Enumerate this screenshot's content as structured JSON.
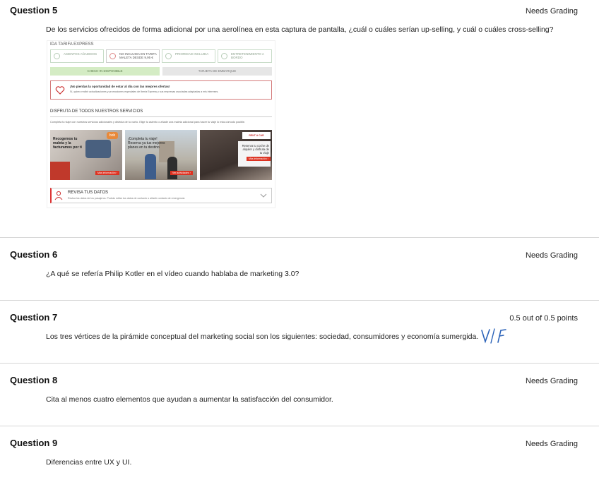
{
  "questions": [
    {
      "title": "Question 5",
      "status": "Needs Grading",
      "text": "De los servicios ofrecidos de forma adicional por una aerolínea en esta captura de pantalla, ¿cuál o cuáles serían up-selling, y cuál o cuáles cross-selling?"
    },
    {
      "title": "Question 6",
      "status": "Needs Grading",
      "text": "¿A qué se refería Philip Kotler en el vídeo cuando hablaba de marketing 3.0?"
    },
    {
      "title": "Question 7",
      "status": "0.5 out of 0.5 points",
      "text": "Los tres vértices de la pirámide conceptual del marketing social son los siguientes: sociedad, consumidores y economía sumergida.",
      "handwritten_mark": "V/F"
    },
    {
      "title": "Question 8",
      "status": "Needs Grading",
      "text": "Cita al menos cuatro elementos que ayudan a aumentar la satisfacción del consumidor."
    },
    {
      "title": "Question 9",
      "status": "Needs Grading",
      "text": "Diferencias entre UX y UI."
    }
  ],
  "screenshot": {
    "header": "IDA TARIFA EXPRESS",
    "services": [
      "ASIENTOS AÑADIDOS",
      "NO INCLUIDA EN TARIFA MALETA DESDE 9,95 €",
      "PRIORIDAD INCLUIDA",
      "ENTRETENIMIENTO A BORDO"
    ],
    "checkin": "CHECK-IN DISPONIBLE",
    "boarding": "TARJETA DE EMBARQUE",
    "promo_title": "¡No pierdas la oportunidad de estar al día con las mejores ofertas!",
    "promo_checkbox": "Sí, quiero recibir actualizaciones y promociones especiales de Iberia Express y sus empresas asociadas adaptadas a mis intereses.",
    "section_title": "DISFRUTA DE TODOS NUESTROS SERVICIOS",
    "section_sub": "Completa tu viaje con nuestros servicios adicionales y disfruta de tu vuelo. Elige tu asiento o añade una maleta adicional para hacer tu viaje lo más cómodo posible.",
    "card1_text": "Recogemos tu maleta y la facturamos por ti",
    "card1_button": "Más información ›",
    "card1_brand": "bob",
    "card2_text": "¡Completa tu viaje! Reserva ya tus mejores planes en tu destino",
    "card2_button": "Ver actividades ›",
    "card3_brand": "RENT A CAR",
    "card3_text": "Reserva tu coche de alquiler y disfruta de tu viaje",
    "card3_button": "Más información ›",
    "review_title": "REVISA TUS DATOS",
    "review_sub": "Revisa los datos de los pasajeros. Podrás editar tus datos de contacto o añadir contacto de emergencia"
  }
}
